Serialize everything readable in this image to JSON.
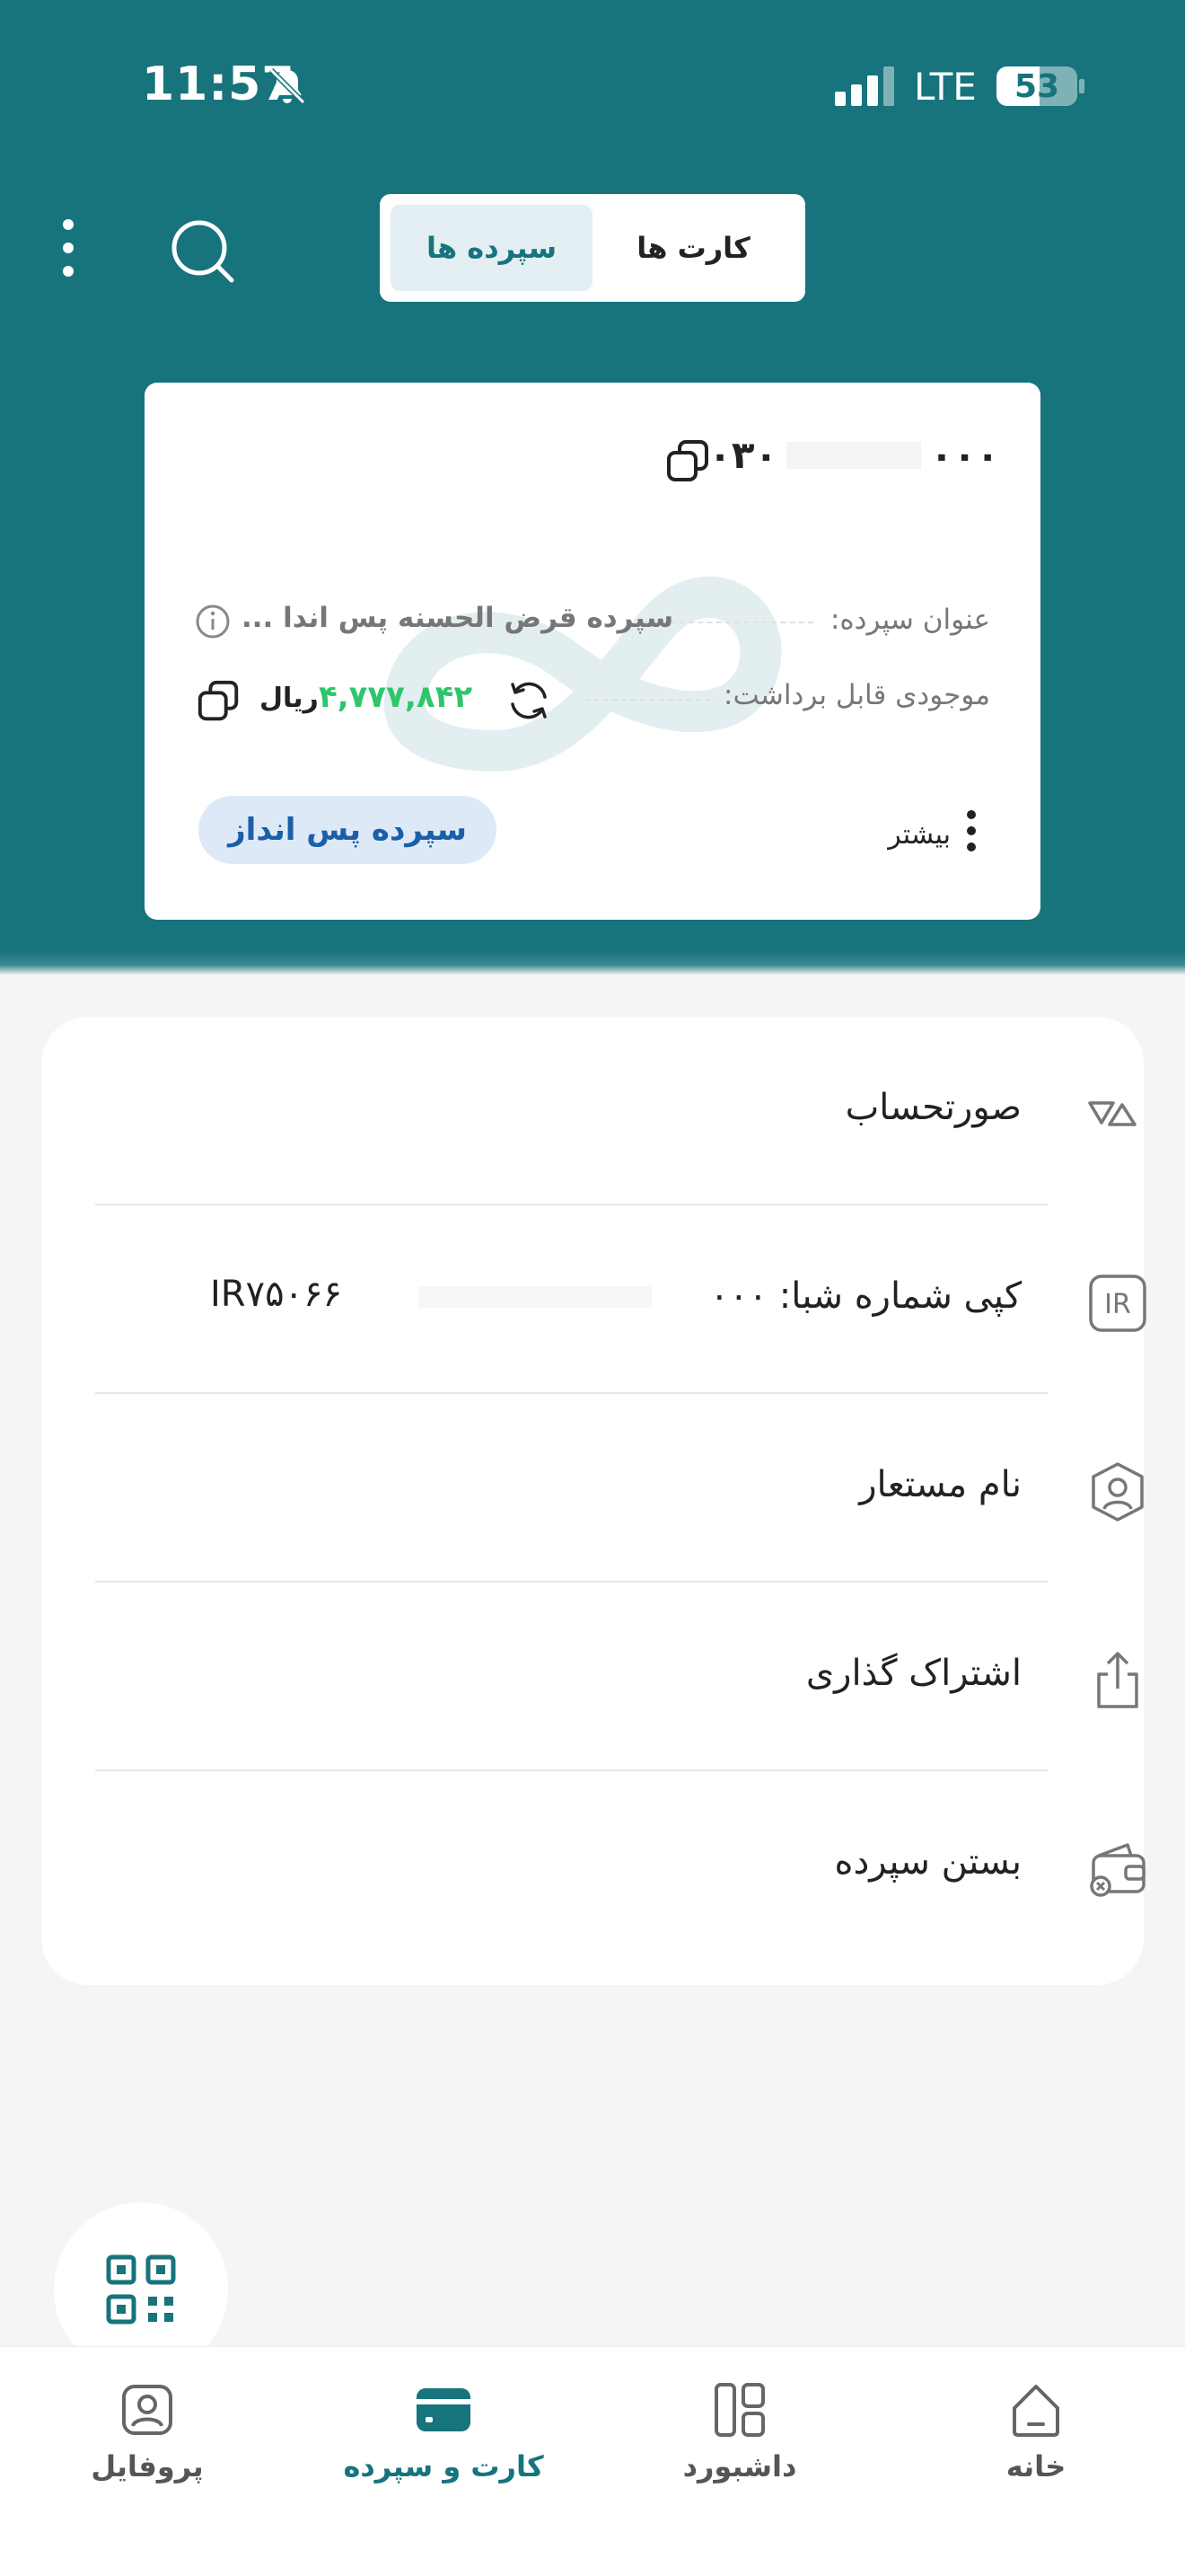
{
  "status_bar": {
    "time": "11:57",
    "network": "LTE",
    "battery": "53"
  },
  "tabs": [
    {
      "label": "کارت ها",
      "active": false
    },
    {
      "label": "سپرده ها",
      "active": true
    }
  ],
  "card": {
    "account_prefix": "۰۳۰",
    "account_suffix": "۰۰۰",
    "title_label": "عنوان سپرده:",
    "title_value": "سپرده قرض الحسنه پس اندا ...",
    "balance_label": "موجودی قابل برداشت:",
    "balance": "۴,۷۷۷,۸۴۲",
    "currency": "ریال",
    "type_pill": "سپرده پس انداز",
    "more": "بیشتر"
  },
  "menu": [
    {
      "label": "صورتحساب",
      "icon": "statement-icon"
    },
    {
      "label": "کپی شماره شبا: ۰۰۰",
      "icon": "ir-icon",
      "iban": "IR۷۵۰۶۶"
    },
    {
      "label": "نام مستعار",
      "icon": "user-badge-icon"
    },
    {
      "label": "اشتراک گذاری",
      "icon": "share-icon"
    },
    {
      "label": "بستن سپرده",
      "icon": "close-wallet-icon"
    }
  ],
  "bottom_nav": [
    {
      "label": "خانه",
      "icon": "home-icon"
    },
    {
      "label": "داشبورد",
      "icon": "dashboard-icon"
    },
    {
      "label": "کارت و سپرده",
      "icon": "card-icon",
      "active": true
    },
    {
      "label": "پروفایل",
      "icon": "profile-icon"
    }
  ],
  "colors": {
    "brand": "#17737c",
    "balance": "#2ec66a",
    "pill_text": "#1b5fa8"
  }
}
